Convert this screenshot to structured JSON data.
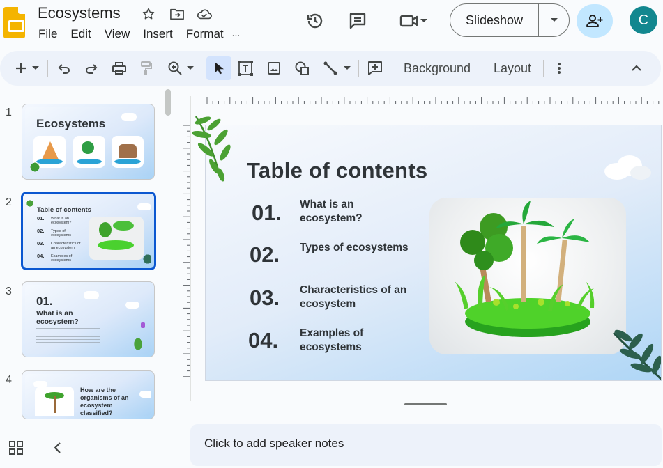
{
  "header": {
    "doc_title": "Ecosystems",
    "menu": [
      "File",
      "Edit",
      "View",
      "Insert",
      "Format",
      "..."
    ],
    "slideshow_label": "Slideshow",
    "avatar_letter": "C",
    "accent_color": "#0b57d0",
    "share_bg": "#c2e7ff",
    "avatar_color": "#12878f"
  },
  "toolbar": {
    "background_label": "Background",
    "layout_label": "Layout"
  },
  "filmstrip": {
    "slides": [
      {
        "number": "1",
        "title": "Ecosystems"
      },
      {
        "number": "2",
        "title": "Table of contents",
        "items": [
          {
            "num": "01.",
            "text": "What is an ecosystem?"
          },
          {
            "num": "02.",
            "text": "Types of ecosystems"
          },
          {
            "num": "03.",
            "text": "Characteristics of an ecosystem"
          },
          {
            "num": "04.",
            "text": "Examples of ecosystems"
          }
        ]
      },
      {
        "number": "3",
        "num": "01.",
        "title": "What is an ecosystem?"
      },
      {
        "number": "4",
        "title": "How are the organisms of an ecosystem classified?"
      }
    ]
  },
  "slide": {
    "title": "Table of contents",
    "items": [
      {
        "num": "01.",
        "text": "What is an ecosystem?"
      },
      {
        "num": "02.",
        "text": "Types of ecosystems"
      },
      {
        "num": "03.",
        "text": "Characteristics of an ecosystem"
      },
      {
        "num": "04.",
        "text": "Examples of ecosystems"
      }
    ]
  },
  "notes": {
    "placeholder": "Click to add speaker notes"
  }
}
